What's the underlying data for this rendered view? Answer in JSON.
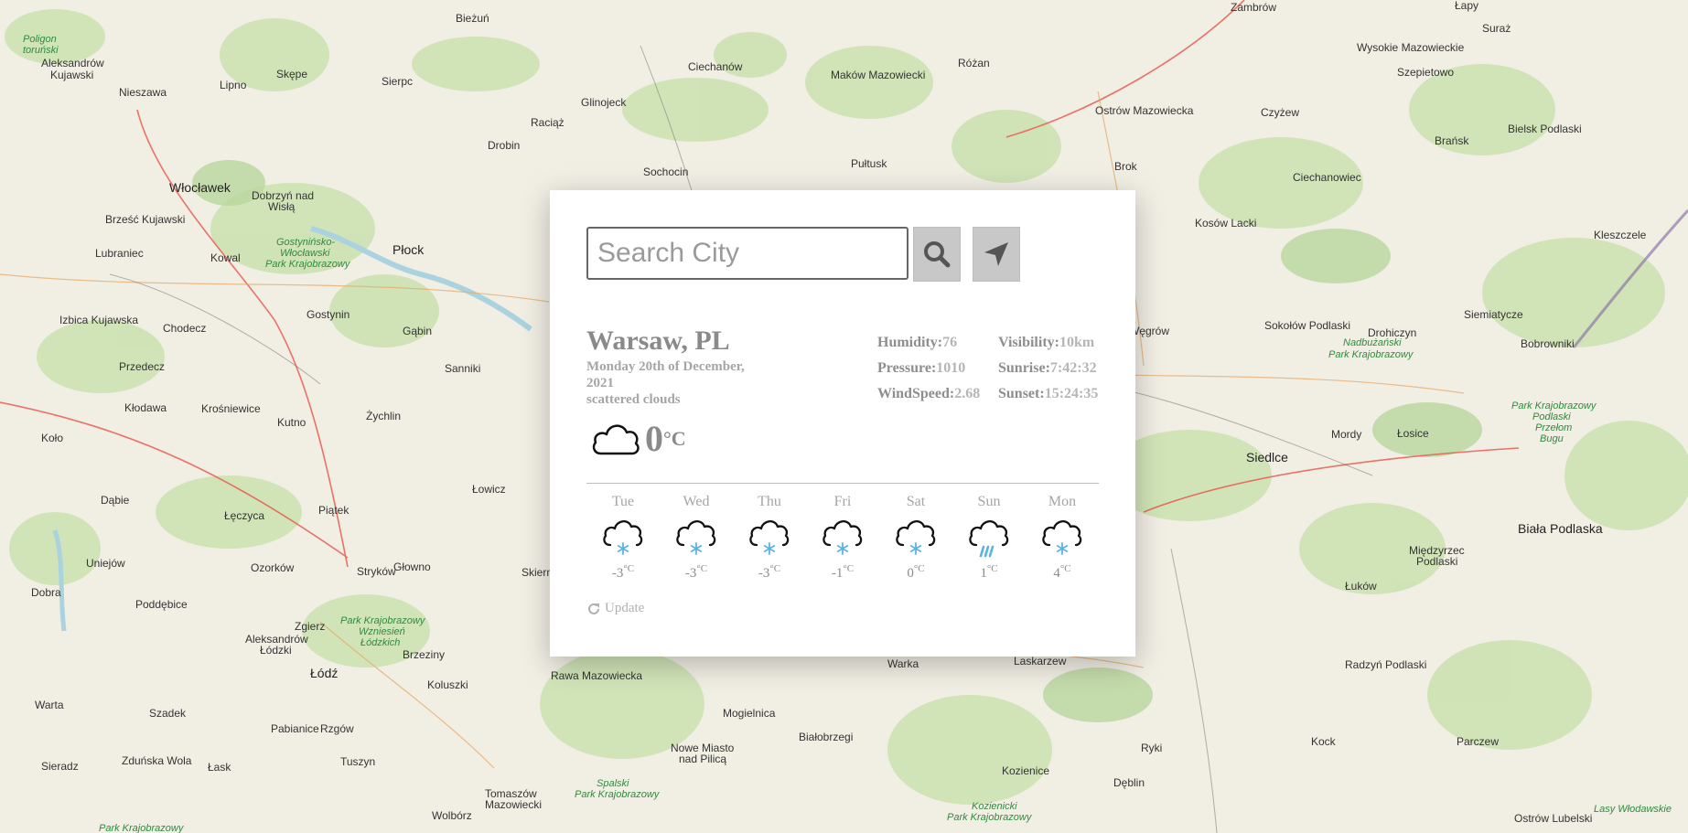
{
  "map": {
    "labels": [
      "Bieżuń",
      "Zambrów",
      "Łapy",
      "Suraż",
      "Aleksandrów Kujawski",
      "Lipno",
      "Skępe",
      "Sierpc",
      "Ciechanów",
      "Maków Mazowiecki",
      "Różan",
      "Wysokie Mazowieckie",
      "Szepietowo",
      "Nieszawa",
      "Glinojeck",
      "Raciąż",
      "Ostrów Mazowiecka",
      "Czyżew",
      "Brańsk",
      "Bielsk Podlaski",
      "Drobin",
      "Sochocin",
      "Pułtusk",
      "Brok",
      "Ciechanowiec",
      "Włocławek",
      "Dobrzyń nad Wisłą",
      "Brześć Kujawski",
      "Kosów Lacki",
      "Kleszczele",
      "Lubraniec",
      "Kowal",
      "Płock",
      "Gostynin",
      "Gąbin",
      "Węgrów",
      "Sokołów Podlaski",
      "Siemiatycze",
      "Drohiczyn",
      "Izbica Kujawska",
      "Chodecz",
      "Przedecz",
      "Sanniki",
      "Kłodawa",
      "Krośniewice",
      "Żychlin",
      "Kutno",
      "Koło",
      "Mordy",
      "Łosice",
      "Siedlce",
      "Dąbie",
      "Łęczyca",
      "Łowicz",
      "Piątek",
      "Uniejów",
      "Ozorków",
      "Głowno",
      "Skierniewice",
      "Biała Podlaska",
      "Międzyrzec Podlaski",
      "Łuków",
      "Dobra",
      "Poddębice",
      "Stryków",
      "Zgierz",
      "Aleksandrów Łódzki",
      "Brzeziny",
      "Łódź",
      "Koluszki",
      "Rawa Mazowiecka",
      "Warka",
      "Laskarzew",
      "Radzyń Podlaski",
      "Warta",
      "Szadek",
      "Pabianice",
      "Rzgów",
      "Mogielnica",
      "Białobrzegi",
      "Nowe Miasto nad Pilicą",
      "Kock",
      "Parczew",
      "Sieradz",
      "Zduńska Wola",
      "Łask",
      "Tuszyn",
      "Tomaszów Mazowiecki",
      "Wolbórz",
      "Kozienice",
      "Ryki",
      "Dęblin",
      "Ostrów Lubelski",
      "Bobrowniki"
    ],
    "parks": [
      "Poligon toruński",
      "Gostynińsko-Włocławski Park Krajobrazowy",
      "Nadbużański Park Krajobrazowy",
      "Park Krajobrazowy Podlaski Przełom Bugu",
      "Park Krajobrazowy Wzniesień Łódzkich",
      "Spalski Park Krajobrazowy",
      "Kozienicki Park Krajobrazowy",
      "Lasy Włodawskie",
      "Park Krajobrazowy"
    ]
  },
  "search": {
    "placeholder": "Search City"
  },
  "buttons": {
    "search_icon": "search-icon",
    "locate_icon": "location-arrow-icon"
  },
  "current": {
    "city": "Warsaw, PL",
    "date": "Monday 20th of December, 2021",
    "description": "scattered clouds",
    "icon": "cloud-icon",
    "temp": "0",
    "unit": "°C"
  },
  "details": {
    "humidity_label": "Humidity:",
    "humidity": "76",
    "visibility_label": "Visibility:",
    "visibility": "10km",
    "pressure_label": "Pressure:",
    "pressure": "1010",
    "sunrise_label": "Sunrise:",
    "sunrise": "7:42:32",
    "windspeed_label": "WindSpeed:",
    "windspeed": "2.68",
    "sunset_label": "Sunset:",
    "sunset": "15:24:35"
  },
  "forecast": [
    {
      "day": "Tue",
      "temp": "-3",
      "unit": "°C",
      "icon": "snow-icon"
    },
    {
      "day": "Wed",
      "temp": "-3",
      "unit": "°C",
      "icon": "snow-icon"
    },
    {
      "day": "Thu",
      "temp": "-3",
      "unit": "°C",
      "icon": "snow-icon"
    },
    {
      "day": "Fri",
      "temp": "-1",
      "unit": "°C",
      "icon": "snow-icon"
    },
    {
      "day": "Sat",
      "temp": "0",
      "unit": "°C",
      "icon": "snow-icon"
    },
    {
      "day": "Sun",
      "temp": "1",
      "unit": "°C",
      "icon": "rain-icon"
    },
    {
      "day": "Mon",
      "temp": "4",
      "unit": "°C",
      "icon": "snow-icon"
    }
  ],
  "update_label": "Update",
  "colors": {
    "precip": "#5ab4e5",
    "park_green": "#2f8a3e",
    "road": "#e8524a"
  }
}
